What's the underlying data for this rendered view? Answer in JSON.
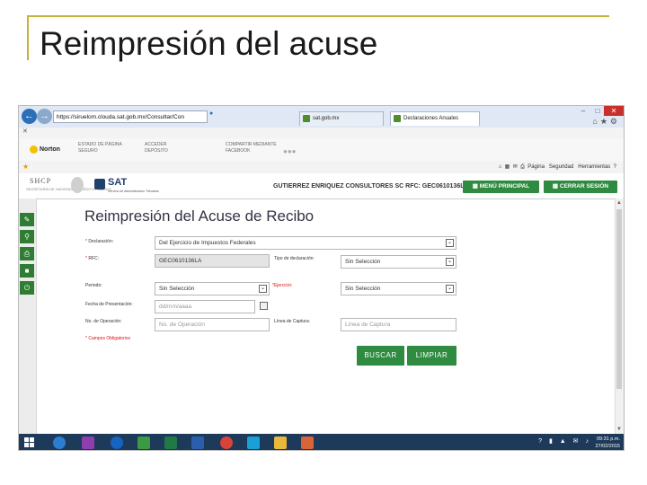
{
  "slide": {
    "title": "Reimpresión del acuse"
  },
  "browser": {
    "url": "https://siruelom.clouda.sat.gob.mx/Consultar/Con",
    "tabs": [
      {
        "label": "sat.gob.mx"
      },
      {
        "label": "Declaraciones Anuales"
      }
    ],
    "norton": {
      "brand": "Norton",
      "items": [
        {
          "line1": "ESTADO DE PÁGINA",
          "line2": "SEGURO"
        },
        {
          "line1": "ACCEDER",
          "line2": "DEPÓSITO"
        },
        {
          "line1": "COMPARTIR MEDIANTE",
          "line2": "FACEBOOK"
        }
      ]
    },
    "toolbar": {
      "page": "Página",
      "security": "Seguridad",
      "tools": "Herramientas"
    }
  },
  "header": {
    "shcp": "SHCP",
    "shcp_sub": "SECRETARÍA DE HACIENDA Y CRÉDITO PÚBLICO",
    "sat": "SAT",
    "sat_sub": "Servicio de Administración Tributaria",
    "company": "GUTIERREZ ENRIQUEZ CONSULTORES SC  RFC: GEC0610136LA",
    "menu_button": "MENÚ PRINCIPAL",
    "logout_button": "CERRAR SESIÓN"
  },
  "form": {
    "title": "Reimpresión del Acuse de Recibo",
    "declaration_label": "Declaración:",
    "declaration_value": "Del Ejercicio de Impuestos Federales",
    "rfc_label": "RFC:",
    "rfc_value": "GEC0610136LA",
    "type_label": "Tipo de declaración:",
    "type_value": "Sin Selección",
    "period_label": "Periodo:",
    "period_value": "Sin Selección",
    "exercise_label": "Ejercicio:",
    "exercise_value": "Sin Selección",
    "date_label": "Fecha de Presentación:",
    "date_placeholder": "dd/mm/aaaa",
    "operation_label": "No. de Operación:",
    "operation_placeholder": "No. de Operación",
    "capture_label": "Línea de Captura:",
    "capture_placeholder": "Línea de Captura",
    "required_note": "* Campos Obligatorios",
    "search_button": "BUSCAR",
    "clear_button": "LIMPIAR"
  },
  "taskbar": {
    "time": "09:31 p.m.",
    "date": "27/02/2015"
  },
  "colors": {
    "accent_green": "#2e8b3f",
    "slide_frame": "#c9b036",
    "taskbar": "#1e3a5a"
  }
}
